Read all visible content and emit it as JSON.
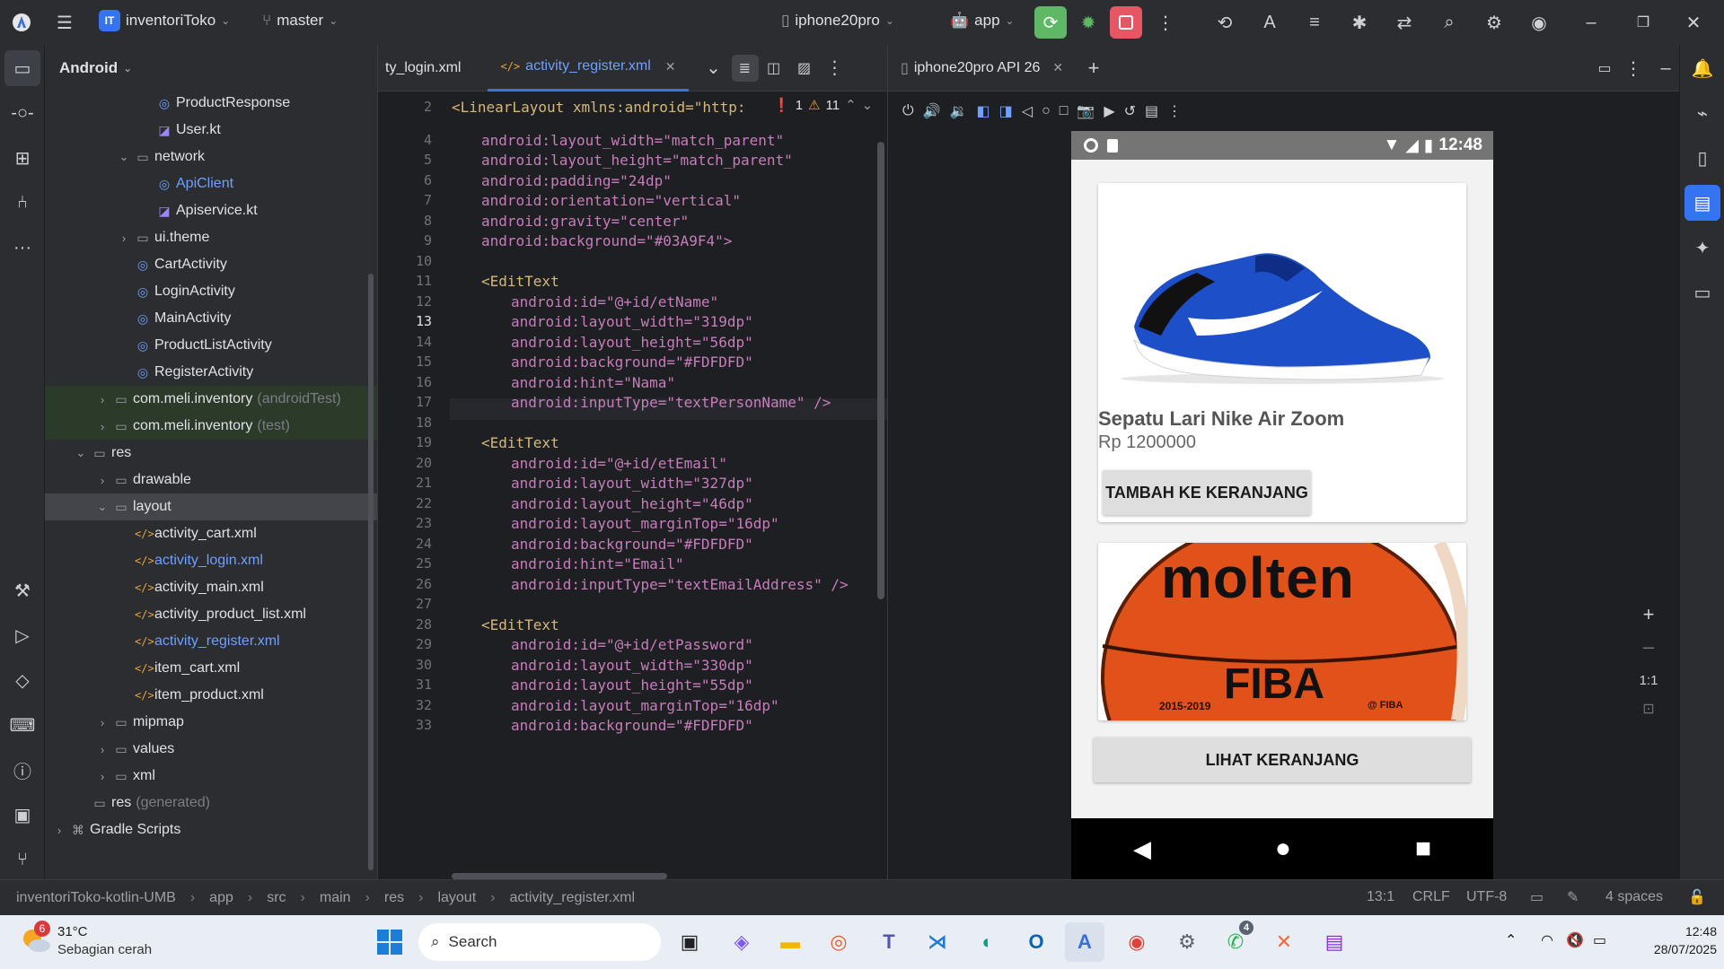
{
  "titlebar": {
    "project_badge": "IT",
    "project_name": "inventoriToko",
    "branch": "master",
    "device": "iphone20pro",
    "run_config": "app"
  },
  "project_panel": {
    "view_label": "Android",
    "tree": [
      {
        "label": "ProductResponse",
        "kind": "class"
      },
      {
        "label": "User.kt",
        "kind": "kotlin"
      },
      {
        "label": "network",
        "kind": "folder"
      },
      {
        "label": "ApiClient",
        "kind": "class"
      },
      {
        "label": "Apiservice.kt",
        "kind": "kotlin"
      },
      {
        "label": "ui.theme",
        "kind": "folder"
      },
      {
        "label": "CartActivity",
        "kind": "class"
      },
      {
        "label": "LoginActivity",
        "kind": "class"
      },
      {
        "label": "MainActivity",
        "kind": "class"
      },
      {
        "label": "ProductListActivity",
        "kind": "class"
      },
      {
        "label": "RegisterActivity",
        "kind": "class"
      },
      {
        "label": "com.meli.inventory",
        "suffix": "(androidTest)",
        "kind": "folder"
      },
      {
        "label": "com.meli.inventory",
        "suffix": "(test)",
        "kind": "folder"
      },
      {
        "label": "res",
        "kind": "folder"
      },
      {
        "label": "drawable",
        "kind": "folder"
      },
      {
        "label": "layout",
        "kind": "folder"
      },
      {
        "label": "activity_cart.xml",
        "kind": "xml"
      },
      {
        "label": "activity_login.xml",
        "kind": "xml"
      },
      {
        "label": "activity_main.xml",
        "kind": "xml"
      },
      {
        "label": "activity_product_list.xml",
        "kind": "xml"
      },
      {
        "label": "activity_register.xml",
        "kind": "xml"
      },
      {
        "label": "item_cart.xml",
        "kind": "xml"
      },
      {
        "label": "item_product.xml",
        "kind": "xml"
      },
      {
        "label": "mipmap",
        "kind": "folder"
      },
      {
        "label": "values",
        "kind": "folder"
      },
      {
        "label": "xml",
        "kind": "folder"
      },
      {
        "label": "res",
        "suffix": "(generated)",
        "kind": "folder"
      },
      {
        "label": "Gradle Scripts",
        "kind": "folder"
      }
    ]
  },
  "editor": {
    "tabs": [
      {
        "label": "ty_login.xml"
      },
      {
        "label": "activity_register.xml",
        "active": true
      }
    ],
    "inspection": {
      "errors": "1",
      "warnings": "11"
    },
    "lines": [
      {
        "n": "2",
        "text": "<LinearLayout xmlns:android=\"http:"
      },
      {
        "n": "4",
        "text": "android:layout_width=\"match_parent\""
      },
      {
        "n": "5",
        "text": "android:layout_height=\"match_parent\""
      },
      {
        "n": "6",
        "text": "android:padding=\"24dp\""
      },
      {
        "n": "7",
        "text": "android:orientation=\"vertical\""
      },
      {
        "n": "8",
        "text": "android:gravity=\"center\""
      },
      {
        "n": "9",
        "text": "android:background=\"#03A9F4\">"
      },
      {
        "n": "10",
        "text": ""
      },
      {
        "n": "11",
        "text": "<EditText"
      },
      {
        "n": "12",
        "text": "android:id=\"@+id/etName\""
      },
      {
        "n": "13",
        "text": "android:layout_width=\"319dp\""
      },
      {
        "n": "14",
        "text": "android:layout_height=\"56dp\""
      },
      {
        "n": "15",
        "text": "android:background=\"#FDFDFD\""
      },
      {
        "n": "16",
        "text": "android:hint=\"Nama\""
      },
      {
        "n": "17",
        "text": "android:inputType=\"textPersonName\" />"
      },
      {
        "n": "18",
        "text": ""
      },
      {
        "n": "19",
        "text": "<EditText"
      },
      {
        "n": "20",
        "text": "android:id=\"@+id/etEmail\""
      },
      {
        "n": "21",
        "text": "android:layout_width=\"327dp\""
      },
      {
        "n": "22",
        "text": "android:layout_height=\"46dp\""
      },
      {
        "n": "23",
        "text": "android:layout_marginTop=\"16dp\""
      },
      {
        "n": "24",
        "text": "android:background=\"#FDFDFD\""
      },
      {
        "n": "25",
        "text": "android:hint=\"Email\""
      },
      {
        "n": "26",
        "text": "android:inputType=\"textEmailAddress\" />"
      },
      {
        "n": "27",
        "text": ""
      },
      {
        "n": "28",
        "text": "<EditText"
      },
      {
        "n": "29",
        "text": "android:id=\"@+id/etPassword\""
      },
      {
        "n": "30",
        "text": "android:layout_width=\"330dp\""
      },
      {
        "n": "31",
        "text": "android:layout_height=\"55dp\""
      },
      {
        "n": "32",
        "text": "android:layout_marginTop=\"16dp\""
      },
      {
        "n": "33",
        "text": "android:background=\"#FDFDFD\""
      }
    ]
  },
  "emulator": {
    "tab_label": "iphone20pro API 26",
    "status_time": "12:48",
    "products": [
      {
        "name": "Sepatu Lari Nike Air Zoom",
        "price": "Rp 1200000",
        "button": "TAMBAH KE KERANJANG"
      },
      {
        "brand_text": "molten",
        "sub_text": "FIBA",
        "years": "2015-2019",
        "logo": "@ FIBA"
      }
    ],
    "view_cart_button": "LIHAT KERANJANG",
    "zoom_label": "1:1"
  },
  "statusbar": {
    "breadcrumbs": [
      "inventoriToko-kotlin-UMB",
      "app",
      "src",
      "main",
      "res",
      "layout",
      "activity_register.xml"
    ],
    "position": "13:1",
    "line_ending": "CRLF",
    "encoding": "UTF-8",
    "indent": "4 spaces"
  },
  "taskbar": {
    "weather_temp": "31°C",
    "weather_desc": "Sebagian cerah",
    "weather_badge": "6",
    "search_label": "Search",
    "whatsapp_badge": "4",
    "time": "12:48",
    "date": "28/07/2025"
  },
  "colors": {
    "accent": "#3574f0",
    "run_green": "#5fb865",
    "stop_red": "#e55765"
  }
}
